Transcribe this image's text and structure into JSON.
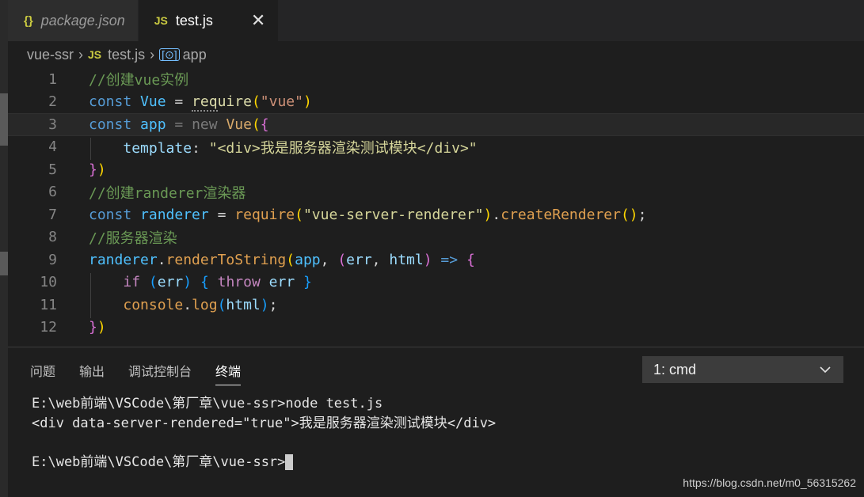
{
  "tabs": [
    {
      "icon": "{}",
      "label": "package.json"
    },
    {
      "icon": "JS",
      "label": "test.js",
      "close": "✕"
    }
  ],
  "breadcrumb": {
    "folder": "vue-ssr",
    "file_icon": "JS",
    "file": "test.js",
    "symbol_icon": "[⊙]",
    "symbol": "app"
  },
  "editor": {
    "line_numbers": [
      "1",
      "2",
      "3",
      "4",
      "5",
      "6",
      "7",
      "8",
      "9",
      "10",
      "11",
      "12"
    ],
    "current_line": 3
  },
  "panel": {
    "tabs": [
      "问题",
      "输出",
      "调试控制台",
      "终端"
    ],
    "active_tab": "终端",
    "terminal_select": "1: cmd"
  },
  "terminal": {
    "lines": [
      "E:\\web前端\\VSCode\\第厂章\\vue-ssr>node test.js",
      "<div data-server-rendered=\"true\">我是服务器渲染测试模块</div>",
      "",
      "E:\\web前端\\VSCode\\第厂章\\vue-ssr>"
    ]
  },
  "watermark": "https://blog.csdn.net/m0_56315262",
  "colors": {
    "editor_bg": "#1e1e1e",
    "keyword": "#569cd6",
    "function": "#dcdcaa",
    "string": "#ce9178",
    "comment": "#6a9955"
  }
}
